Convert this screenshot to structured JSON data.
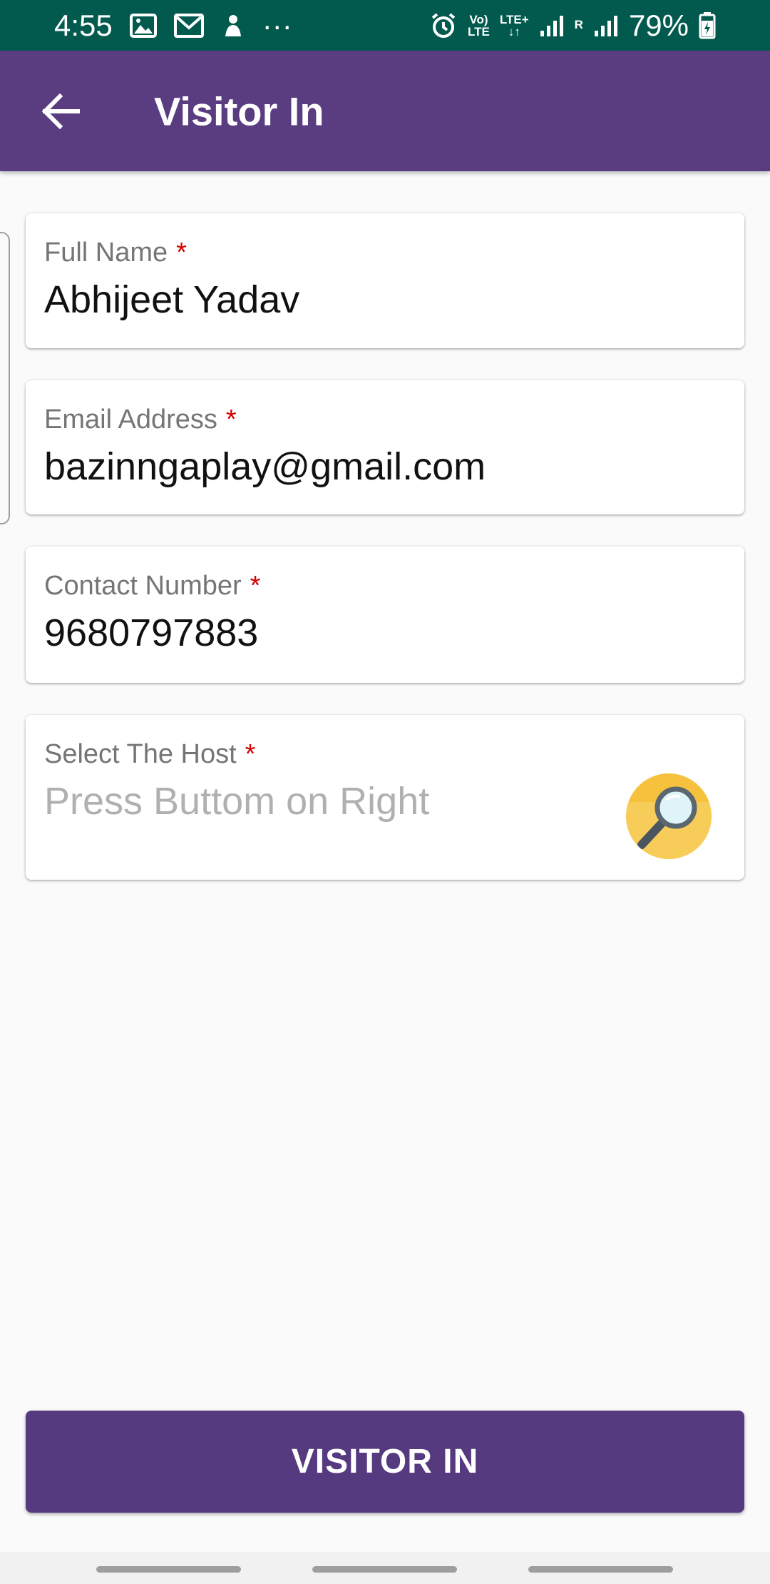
{
  "status_bar": {
    "time": "4:55",
    "more": "···",
    "volte_top": "Vo)",
    "volte_bottom": "LTE",
    "lte_plus": "LTE+",
    "roaming": "R",
    "battery_percent": "79%",
    "left_icons": [
      "gallery-icon",
      "gmail-icon",
      "notification-icon"
    ],
    "right_icons": [
      "alarm-icon",
      "signal-icon",
      "battery-charging-icon"
    ]
  },
  "app_bar": {
    "title": "Visitor In",
    "back_icon": "arrow-left-icon"
  },
  "form": {
    "full_name": {
      "label": "Full Name",
      "required": "*",
      "value": "Abhijeet Yadav"
    },
    "email": {
      "label": "Email Address",
      "required": "*",
      "value": "bazinngaplay@gmail.com"
    },
    "contact": {
      "label": "Contact Number",
      "required": "*",
      "value": "9680797883"
    },
    "host": {
      "label": "Select The Host",
      "required": "*",
      "placeholder": "Press Buttom on Right",
      "search_icon": "magnifier-icon"
    }
  },
  "actions": {
    "visitor_in_label": "VISITOR IN"
  },
  "colors": {
    "status_bar": "#015a4d",
    "app_bar": "#5a3d80",
    "primary_button": "#553a80",
    "required_asterisk": "#d50000",
    "search_button": "#f6c23e"
  }
}
